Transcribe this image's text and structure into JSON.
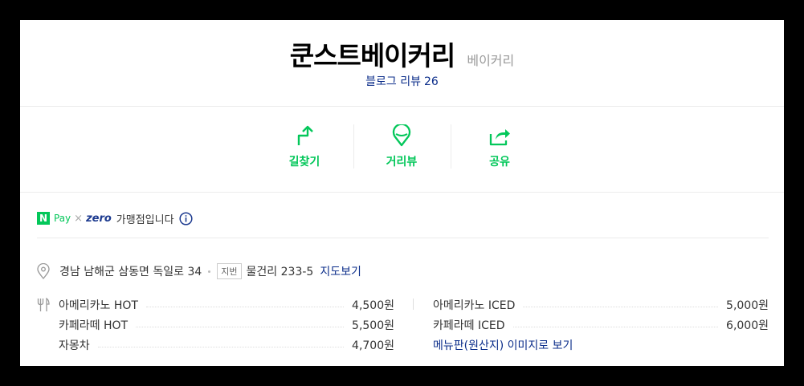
{
  "place": {
    "name": "쿤스트베이커리",
    "category": "베이커리",
    "review_label": "블로그 리뷰",
    "review_count": "26"
  },
  "actions": [
    {
      "label": "길찾기",
      "icon": "directions-icon"
    },
    {
      "label": "거리뷰",
      "icon": "street-view-icon"
    },
    {
      "label": "공유",
      "icon": "share-icon"
    }
  ],
  "pay": {
    "npay_mark": "N",
    "npay_text": "Pay",
    "times": "×",
    "zero": "zero",
    "merchant_text": "가맹점입니다"
  },
  "address": {
    "road": "경남 남해군 삼동면 독일로 34",
    "jibun_badge": "지번",
    "jibun": "물건리 233-5",
    "map_link": "지도보기"
  },
  "menu": {
    "left": [
      {
        "name": "아메리카노 HOT",
        "price": "4,500원"
      },
      {
        "name": "카페라떼 HOT",
        "price": "5,500원"
      },
      {
        "name": "자몽차",
        "price": "4,700원"
      }
    ],
    "right": [
      {
        "name": "아메리카노 ICED",
        "price": "5,000원"
      },
      {
        "name": "카페라떼 ICED",
        "price": "6,000원"
      }
    ],
    "menu_image_link": "메뉴판(원산지) 이미지로 보기"
  },
  "colors": {
    "accent_green": "#03c75a",
    "link_blue": "#0b2d8a"
  }
}
